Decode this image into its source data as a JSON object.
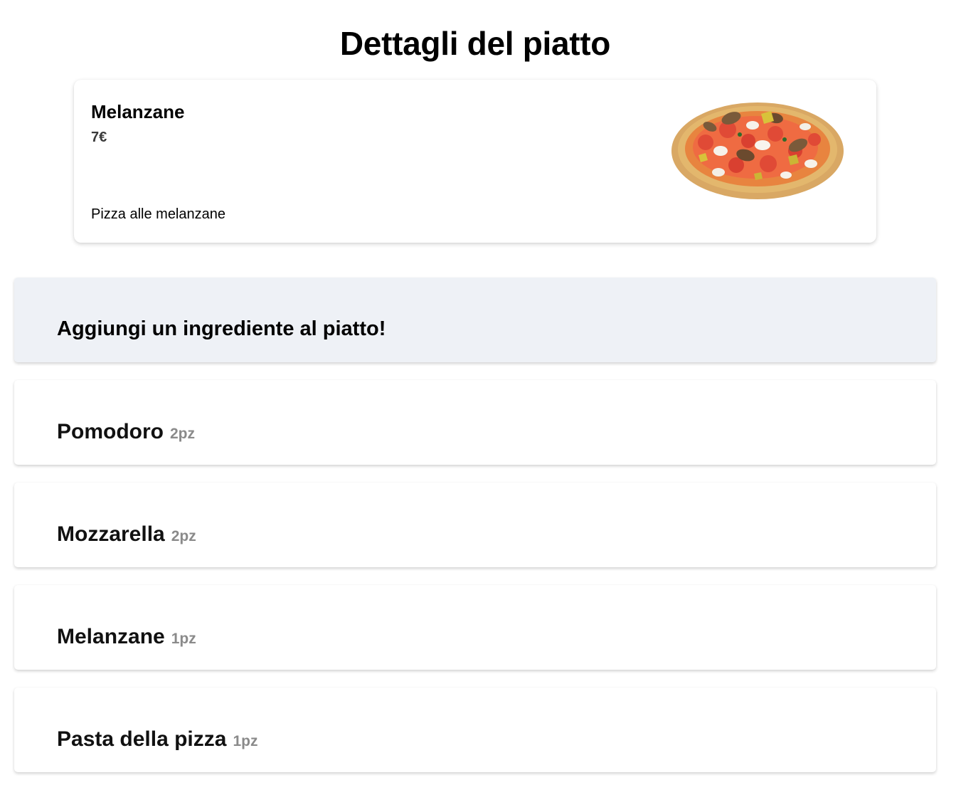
{
  "page": {
    "title": "Dettagli del piatto"
  },
  "dish": {
    "name": "Melanzane",
    "price": "7€",
    "description": "Pizza alle melanzane",
    "image_icon": "pizza-image"
  },
  "add_ingredient": {
    "label": "Aggiungi un ingrediente al piatto!"
  },
  "ingredients": [
    {
      "name": "Pomodoro",
      "qty": "2pz"
    },
    {
      "name": "Mozzarella",
      "qty": "2pz"
    },
    {
      "name": "Melanzane",
      "qty": "1pz"
    },
    {
      "name": "Pasta della pizza",
      "qty": "1pz"
    }
  ],
  "colors": {
    "add_bar_background": "#eef1f6",
    "qty_text": "#8a8a8a",
    "price_text": "#3a3a3a"
  }
}
